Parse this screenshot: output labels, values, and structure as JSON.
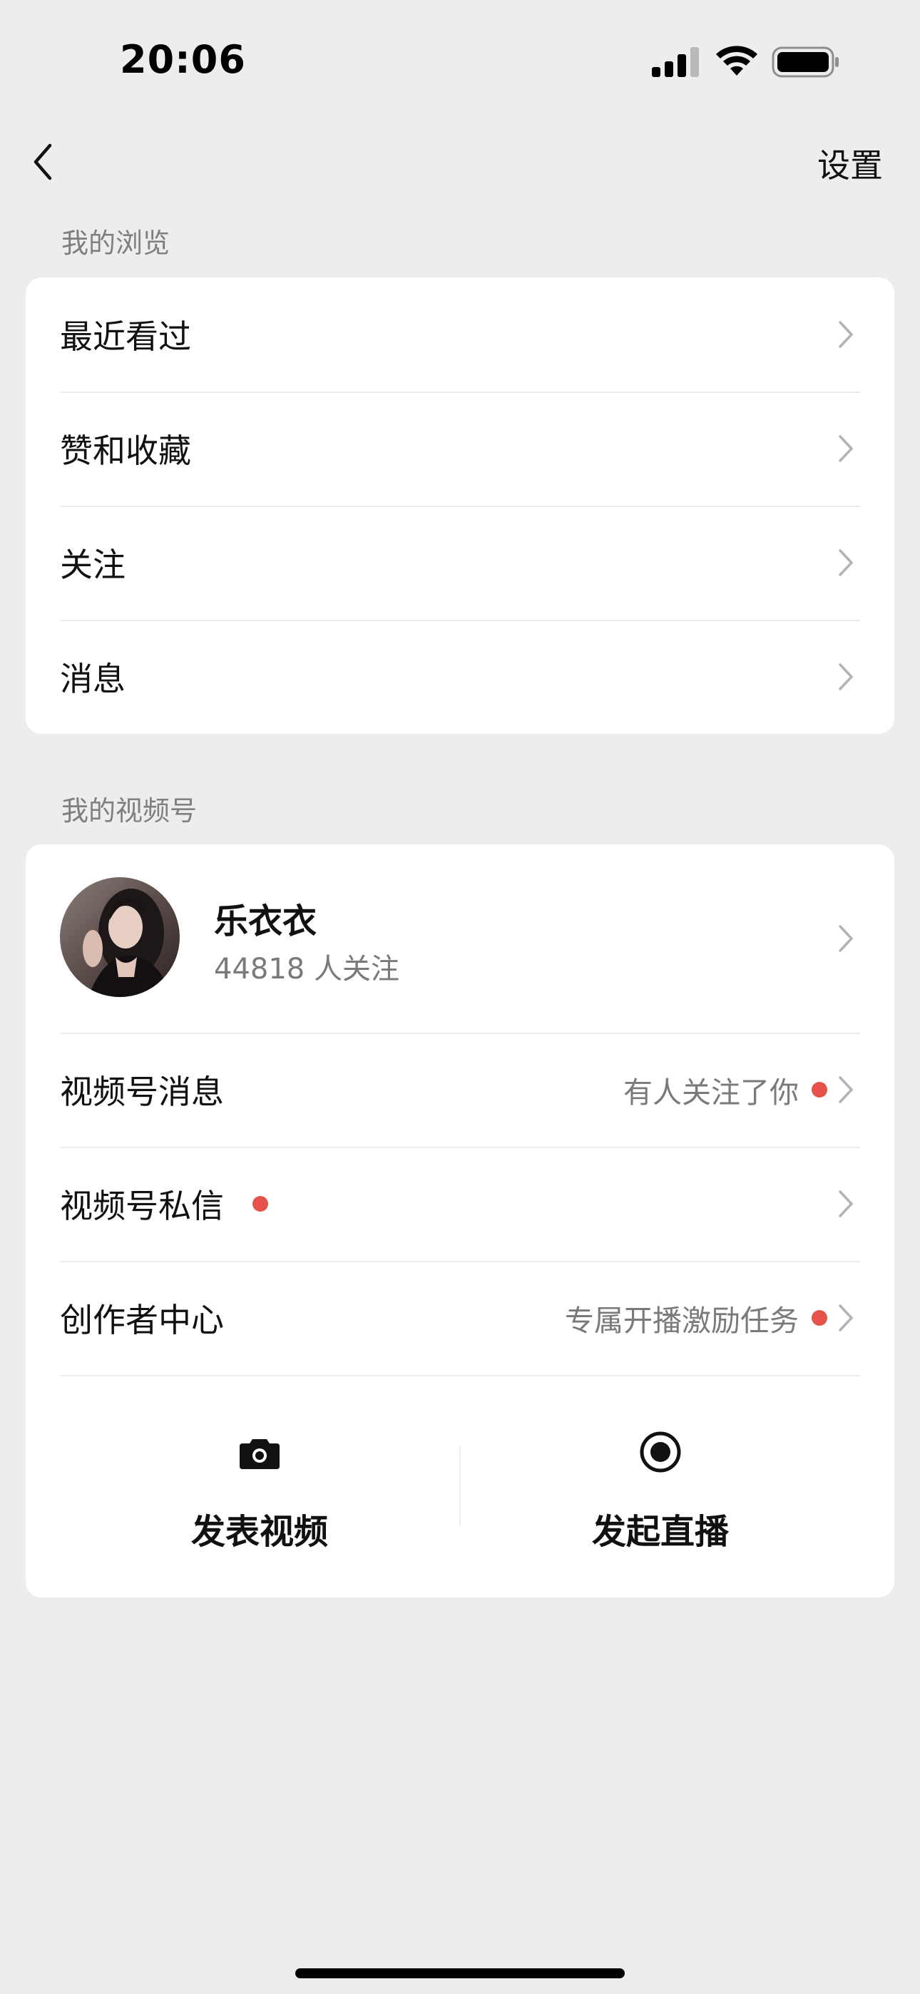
{
  "status_bar": {
    "time": "20:06"
  },
  "nav": {
    "settings_label": "设置"
  },
  "browsing": {
    "section_label": "我的浏览",
    "items": [
      {
        "label": "最近看过"
      },
      {
        "label": "赞和收藏"
      },
      {
        "label": "关注"
      },
      {
        "label": "消息"
      }
    ]
  },
  "channels": {
    "section_label": "我的视频号",
    "profile": {
      "name": "乐衣衣",
      "followers": "44818 人关注"
    },
    "items": [
      {
        "label": "视频号消息",
        "right_text": "有人关注了你",
        "dot": true
      },
      {
        "label": "视频号私信",
        "right_text": "",
        "dot": true
      },
      {
        "label": "创作者中心",
        "right_text": "专属开播激励任务",
        "dot": true
      }
    ],
    "actions": [
      {
        "label": "发表视频",
        "icon": "camera-icon"
      },
      {
        "label": "发起直播",
        "icon": "live-record-icon"
      }
    ]
  },
  "colors": {
    "background": "#ededed",
    "card": "#ffffff",
    "dot": "#e5534b",
    "secondary_text": "#7a7a7a"
  }
}
